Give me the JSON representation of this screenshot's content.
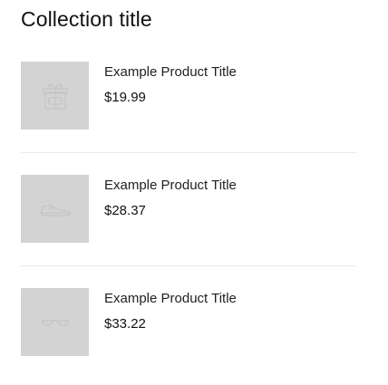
{
  "collection": {
    "title": "Collection title"
  },
  "products": [
    {
      "title": "Example Product Title",
      "price": "$19.99",
      "icon": "gift-icon"
    },
    {
      "title": "Example Product Title",
      "price": "$28.37",
      "icon": "shoe-icon"
    },
    {
      "title": "Example Product Title",
      "price": "$33.22",
      "icon": "sunglasses-icon"
    }
  ],
  "colors": {
    "placeholder_bg": "#d3d3d3",
    "placeholder_icon": "#c2c2c2",
    "divider": "#e9e9e9",
    "text": "#121212"
  }
}
